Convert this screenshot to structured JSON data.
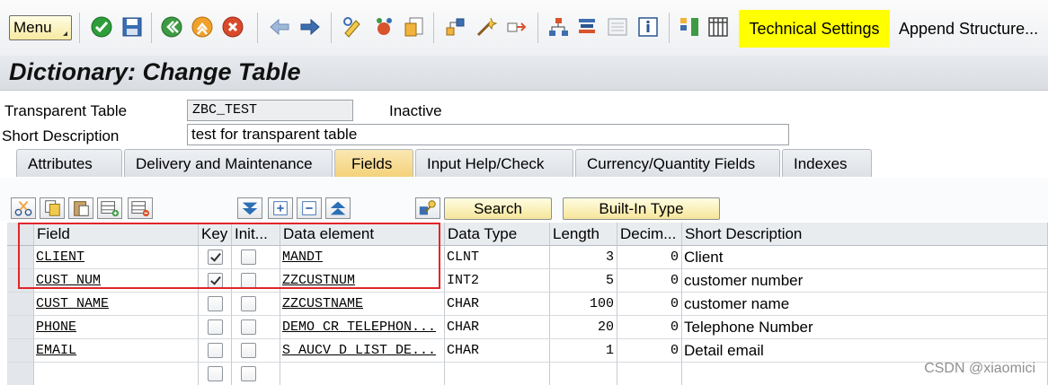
{
  "toolbar": {
    "menu_label": "Menu",
    "icons": [
      "save-check-icon",
      "save-disk-icon",
      "back-icon",
      "exit-icon",
      "cancel-icon",
      "previous-object-icon",
      "next-object-icon",
      "display-change-icon",
      "activate-icon",
      "where-used-icon",
      "object-list-icon",
      "hierarchy-icon",
      "other-object-icon",
      "navigation-icon",
      "table-structure-icon",
      "info-icon",
      "contents-icon",
      "column-layout-icon"
    ],
    "technical_settings": "Technical Settings",
    "append_structure": "Append Structure..."
  },
  "title": "Dictionary: Change Table",
  "header": {
    "transparent_table_label": "Transparent Table",
    "transparent_table_value": "ZBC_TEST",
    "status": "Inactive",
    "short_description_label": "Short Description",
    "short_description_value": "test for transparent table"
  },
  "tabs": [
    {
      "label": "Attributes",
      "active": false
    },
    {
      "label": "Delivery and Maintenance",
      "active": false
    },
    {
      "label": "Fields",
      "active": true
    },
    {
      "label": "Input Help/Check",
      "active": false
    },
    {
      "label": "Currency/Quantity Fields",
      "active": false
    },
    {
      "label": "Indexes",
      "active": false
    }
  ],
  "grid_toolbar": {
    "search_label": "Search",
    "builtin_label": "Built-In Type"
  },
  "table": {
    "columns": [
      "Field",
      "Key",
      "Init...",
      "Data element",
      "Data Type",
      "Length",
      "Decim...",
      "Short Description"
    ],
    "rows": [
      {
        "field": "CLIENT",
        "key": true,
        "init": false,
        "data_element": "MANDT",
        "data_type": "CLNT",
        "length": "3",
        "decimals": "0",
        "description": "Client"
      },
      {
        "field": "CUST_NUM",
        "key": true,
        "init": false,
        "data_element": "ZZCUSTNUM",
        "data_type": "INT2",
        "length": "5",
        "decimals": "0",
        "description": "customer number"
      },
      {
        "field": "CUST_NAME",
        "key": false,
        "init": false,
        "data_element": "ZZCUSTNAME",
        "data_type": "CHAR",
        "length": "100",
        "decimals": "0",
        "description": "customer name"
      },
      {
        "field": "PHONE",
        "key": false,
        "init": false,
        "data_element": "DEMO_CR_TELEPHON...",
        "data_type": "CHAR",
        "length": "20",
        "decimals": "0",
        "description": "Telephone Number"
      },
      {
        "field": "EMAIL",
        "key": false,
        "init": false,
        "data_element": "S_AUCV_D_LIST_DE...",
        "data_type": "CHAR",
        "length": "1",
        "decimals": "0",
        "description": "Detail email"
      },
      {
        "field": "",
        "key": false,
        "init": false,
        "data_element": "",
        "data_type": "",
        "length": "",
        "decimals": "",
        "description": ""
      }
    ]
  },
  "watermark": "CSDN @xiaomici",
  "colors": {
    "highlight": "#ffff00",
    "annotation_box": "#e0262b",
    "active_tab": "#f4d27a"
  }
}
